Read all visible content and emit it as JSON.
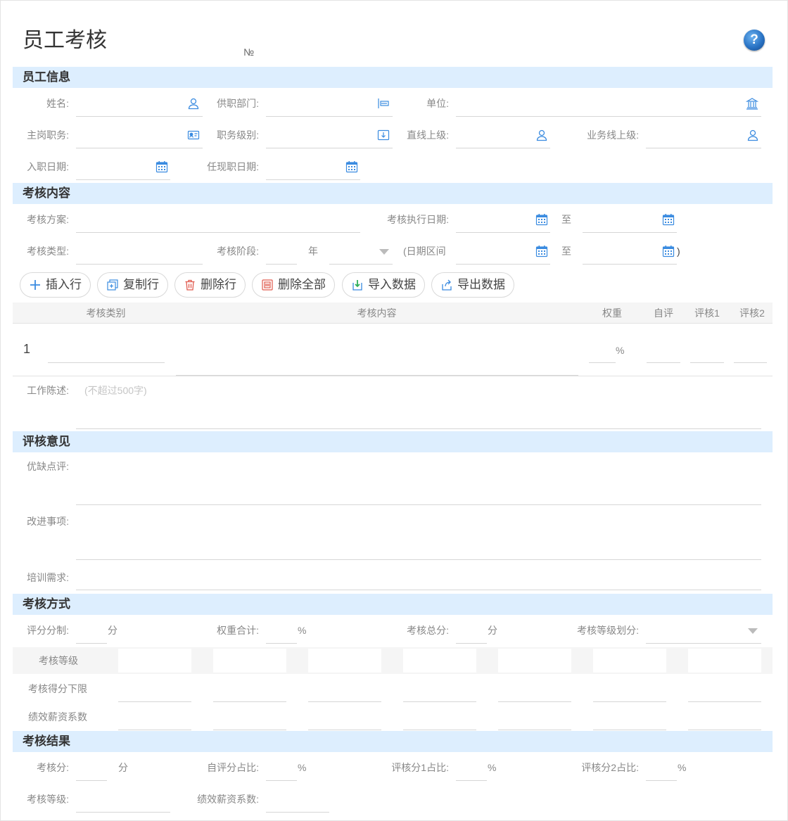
{
  "header": {
    "title": "员工考核",
    "no_mark": "№",
    "help_label": "?"
  },
  "sections": {
    "employee": "员工信息",
    "content": "考核内容",
    "review": "评核意见",
    "method": "考核方式",
    "result": "考核结果"
  },
  "employee": {
    "name_label": "姓名:",
    "dept_label": "供职部门:",
    "unit_label": "单位:",
    "position_label": "主岗职务:",
    "level_label": "职务级别:",
    "direct_sup_label": "直线上级:",
    "biz_sup_label": "业务线上级:",
    "entry_date_label": "入职日期:",
    "current_date_label": "任现职日期:"
  },
  "content": {
    "plan_label": "考核方案:",
    "exec_date_label": "考核执行日期:",
    "to1": "至",
    "type_label": "考核类型:",
    "stage_label": "考核阶段:",
    "year_unit": "年",
    "range_open": "(日期区间",
    "to2": "至",
    "range_close": ")"
  },
  "toolbar": {
    "insert": "插入行",
    "copy": "复制行",
    "delete": "删除行",
    "delete_all": "删除全部",
    "import": "导入数据",
    "export": "导出数据"
  },
  "table": {
    "headers": [
      "考核类别",
      "考核内容",
      "权重",
      "自评",
      "评核1",
      "评核2"
    ],
    "row_index": "1",
    "weight_unit": "%"
  },
  "work": {
    "label": "工作陈述:",
    "placeholder": "(不超过500字)"
  },
  "review": {
    "strengths_label": "优缺点评:",
    "improve_label": "改进事项:",
    "training_label": "培训需求:"
  },
  "method": {
    "score_system_label": "评分分制:",
    "score_unit": "分",
    "weight_total_label": "权重合计:",
    "weight_unit": "%",
    "total_score_label": "考核总分:",
    "total_unit": "分",
    "grade_division_label": "考核等级划分:",
    "grade_row_label": "考核等级",
    "lower_limit_label": "考核得分下限",
    "salary_coef_label": "绩效薪资系数"
  },
  "result": {
    "score_label": "考核分:",
    "score_unit": "分",
    "self_ratio_label": "自评分占比:",
    "self_unit": "%",
    "r1_ratio_label": "评核分1占比:",
    "r1_unit": "%",
    "r2_ratio_label": "评核分2占比:",
    "r2_unit": "%",
    "grade_label": "考核等级:",
    "coef_label": "绩效薪资系数:"
  },
  "colors": {
    "section_bg": "#ddeefe",
    "accent_icon": "#3a8be0"
  }
}
